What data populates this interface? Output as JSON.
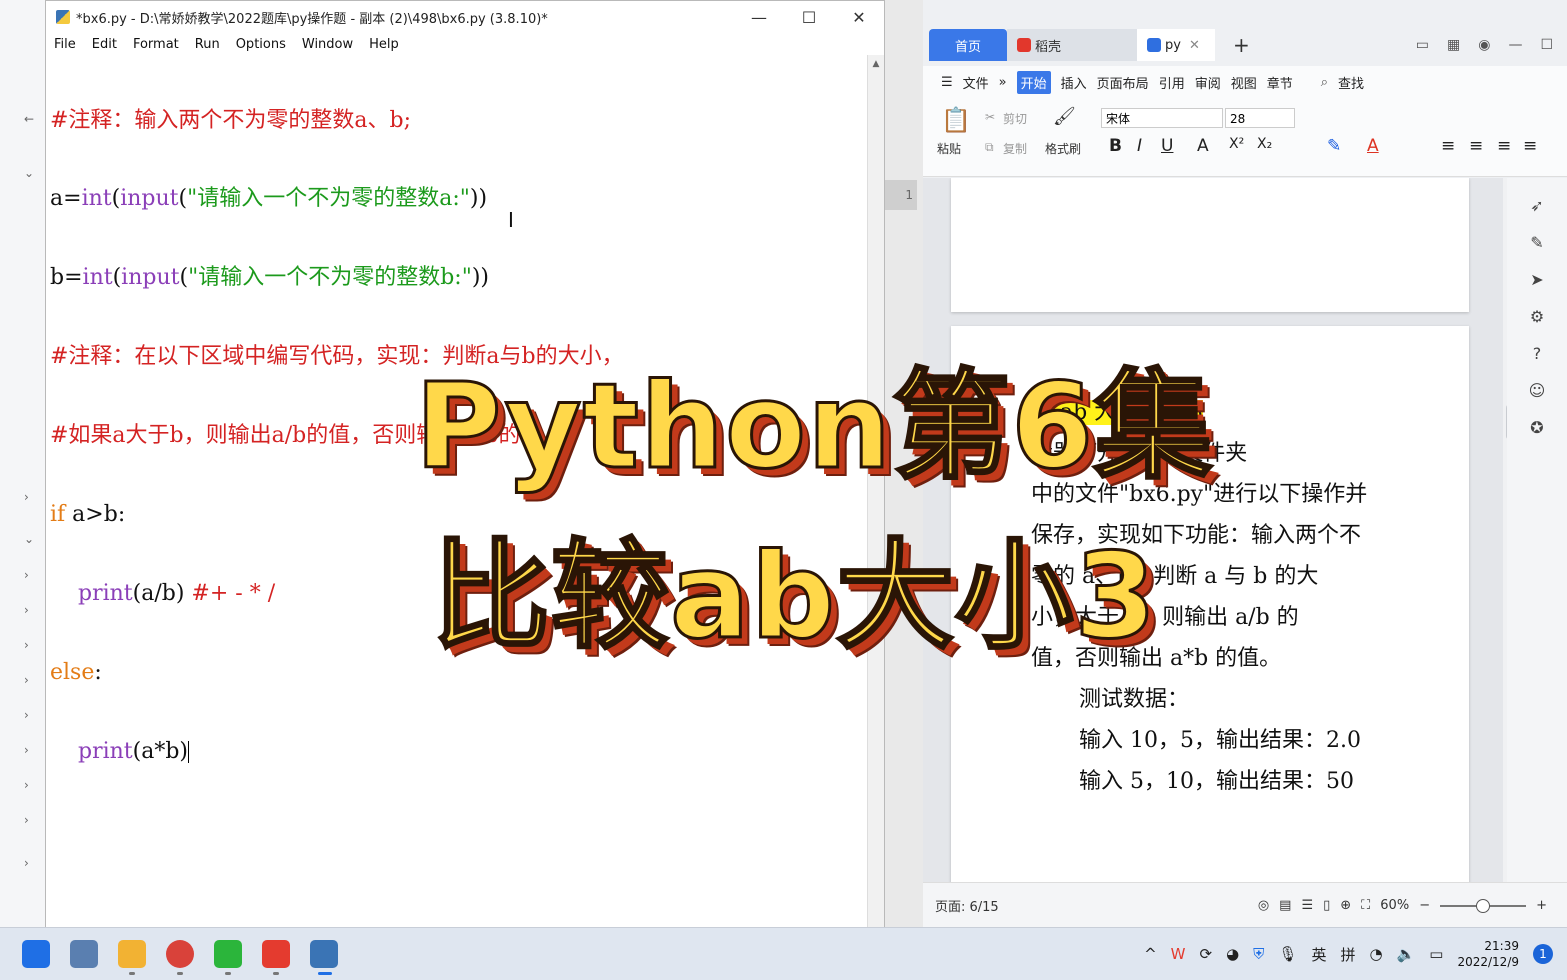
{
  "idle": {
    "title": "*bx6.py - D:\\常娇娇教学\\2022题库\\py操作题 - 副本 (2)\\498\\bx6.py (3.8.10)*",
    "window_buttons": [
      "—",
      "☐",
      "✕"
    ],
    "menu": [
      "File",
      "Edit",
      "Format",
      "Run",
      "Options",
      "Window",
      "Help"
    ],
    "code": {
      "l1": "#注释：输入两个不为零的整数a、b;",
      "l2_a": "a=",
      "l2_int": "int",
      "l2_p1": "(",
      "l2_input": "input",
      "l2_p2": "(",
      "l2_str": "\"请输入一个不为零的整数a:\"",
      "l2_p3": "))",
      "l3_a": "b=",
      "l3_int": "int",
      "l3_p1": "(",
      "l3_input": "input",
      "l3_p2": "(",
      "l3_str": "\"请输入一个不为零的整数b:\"",
      "l3_p3": "))",
      "l4": "#注释：在以下区域中编写代码，实现：判断a与b的大小，",
      "l5": "#如果a大于b，则输出a/b的值，否则输出a*b的值。",
      "l6_kw": "if",
      "l6_rest": " a>b:",
      "l7_ind": "    ",
      "l7_print": "print",
      "l7_args": "(a/b) ",
      "l7_cmt": "#+ - * /",
      "l8_kw": "else",
      "l8_rest": ":",
      "l9_ind": "    ",
      "l9_print": "print",
      "l9_args": "(a*b)"
    },
    "gutter_number": "1"
  },
  "wps": {
    "tabs": {
      "home": "首页",
      "daoke": "稻壳",
      "doc": "py"
    },
    "menus": [
      "文件",
      "»",
      "开始",
      "插入",
      "页面布局",
      "引用",
      "审阅",
      "视图",
      "章节"
    ],
    "search": "查找",
    "ribbon": {
      "paste": "粘贴",
      "cut": "剪切",
      "copy": "复制",
      "format_painter": "格式刷",
      "font_name": "宋体",
      "font_size": "28"
    },
    "doc_lines": [
      "较 ab 大小题目 3",
      "辑器打开\"498\"文件夹",
      "中的文件\"bx6.py\"进行以下操作并",
      "保存，实现如下功能：输入两个不",
      "零的 a、b，判断 a 与 b 的大",
      "小，大于 b，则输出 a/b 的",
      "值，否则输出 a*b 的值。",
      "测试数据：",
      "输入 10，5，输出结果：2.0",
      "输入 5，10，输出结果：50"
    ],
    "status": {
      "page": "页面: 6/15",
      "zoom": "60%"
    }
  },
  "overlay": {
    "line1": "Python第6集",
    "line2": "比较ab大小3"
  },
  "taskbar": {
    "ime1": "英",
    "ime2": "拼",
    "time": "21:39",
    "date": "2022/12/9",
    "notifications": "1"
  },
  "colors": {
    "accent": "#3a78e8",
    "comment": "#d42323",
    "string": "#1c9a1c",
    "keyword": "#e37c16",
    "builtin": "#8b3fb8",
    "title_fill": "#ffd84a",
    "title_shadow": "#c23a1b"
  }
}
